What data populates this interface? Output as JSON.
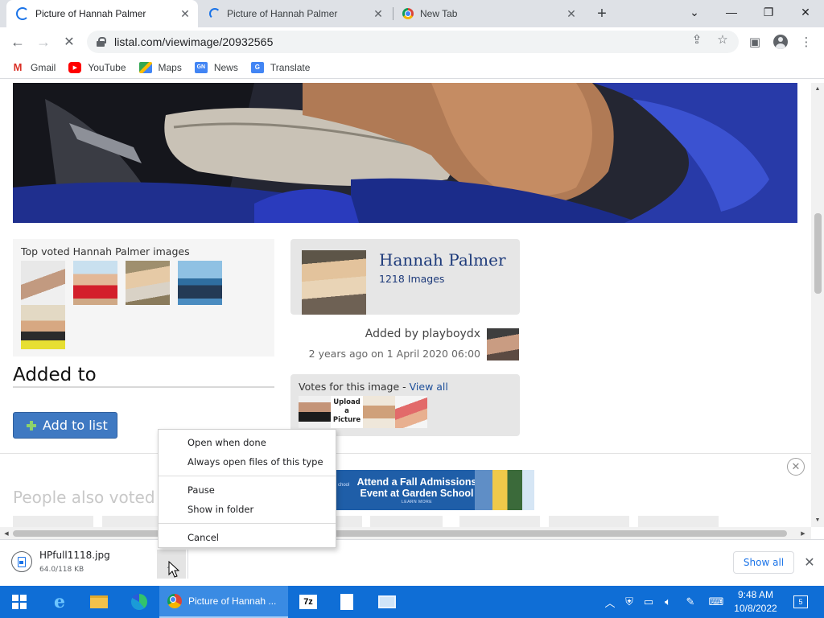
{
  "browser": {
    "tabs": [
      {
        "title": "Picture of Hannah Palmer",
        "active": true,
        "loading": true
      },
      {
        "title": "Picture of Hannah Palmer",
        "active": false,
        "loading": true
      },
      {
        "title": "New Tab",
        "active": false,
        "loading": false
      }
    ],
    "url": "listal.com/viewimage/20932565",
    "bookmarks": [
      {
        "label": "Gmail",
        "icon": "gmail-icon"
      },
      {
        "label": "YouTube",
        "icon": "youtube-icon"
      },
      {
        "label": "Maps",
        "icon": "maps-icon"
      },
      {
        "label": "News",
        "icon": "news-icon"
      },
      {
        "label": "Translate",
        "icon": "translate-icon"
      }
    ]
  },
  "page": {
    "top_voted_heading": "Top voted Hannah Palmer images",
    "added_to_heading": "Added to",
    "add_to_list_label": "Add to list",
    "person": {
      "name": "Hannah Palmer",
      "image_count": "1218 Images"
    },
    "added_by_prefix": "Added by",
    "added_by_user": "playboydx",
    "added_date": "2 years ago on 1 April 2020 06:00",
    "votes_label": "Votes for this image - ",
    "votes_link": "View all",
    "upload_tile": "Upload a Picture",
    "people_also_voted": "People also voted f",
    "ad": {
      "headline": "Attend a Fall Admissions Event at Garden School",
      "cta": "LEARN MORE",
      "school_fragment": "chool"
    }
  },
  "context_menu": {
    "items": [
      "Open when done",
      "Always open files of this type",
      "Pause",
      "Show in folder",
      "Cancel"
    ]
  },
  "download_shelf": {
    "file_name": "HPfull1118.jpg",
    "progress": "64.0/118 KB",
    "show_all": "Show all"
  },
  "taskbar": {
    "chrome_label": "Picture of Hannah ...",
    "time": "9:48 AM",
    "date": "10/8/2022",
    "notification_count": "5"
  },
  "colors": {
    "accent": "#1a73e8",
    "listal_link": "#1d3a7a",
    "add_button": "#3f79c2",
    "taskbar": "#0f6ed6"
  }
}
